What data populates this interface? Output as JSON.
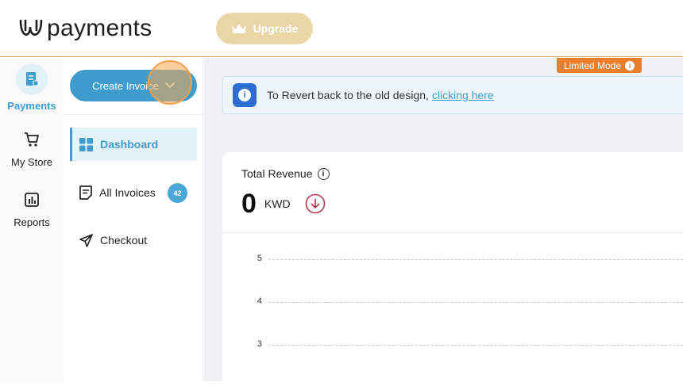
{
  "header": {
    "logo_text": "payments",
    "upgrade_label": "Upgrade"
  },
  "rail": {
    "items": [
      {
        "label": "Payments",
        "icon": "payments-icon",
        "active": true
      },
      {
        "label": "My Store",
        "icon": "cart-icon"
      },
      {
        "label": "Reports",
        "icon": "reports-icon"
      }
    ]
  },
  "subnav": {
    "create_label": "Create Invoice",
    "items": [
      {
        "label": "Dashboard",
        "icon": "dashboard-icon",
        "active": true
      },
      {
        "label": "All Invoices",
        "icon": "invoice-icon",
        "badge": "42"
      },
      {
        "label": "Checkout",
        "icon": "send-icon"
      }
    ]
  },
  "main": {
    "limited_label": "Limited Mode",
    "notice_text": "To Revert back to the old design,",
    "notice_link": "clicking here",
    "revenue": {
      "title": "Total Revenue",
      "value": "0",
      "currency": "KWD"
    }
  },
  "chart_data": {
    "type": "line",
    "title": "",
    "xlabel": "",
    "ylabel": "",
    "y_ticks": [
      "5",
      "4",
      "3"
    ],
    "grid": true
  },
  "colors": {
    "accent": "#3f9ccc",
    "upgrade": "#ead6a7",
    "limited": "#e97f2d",
    "header_border": "#e8a055"
  }
}
